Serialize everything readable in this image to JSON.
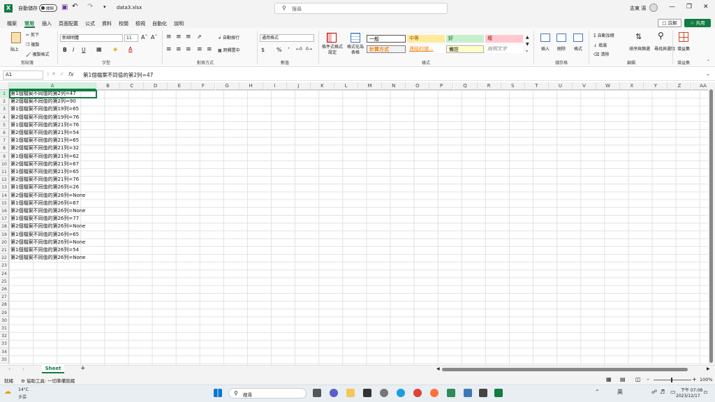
{
  "titlebar": {
    "autosave_label": "自動儲存",
    "autosave_state": "關閉",
    "filename": "data3.xlsx",
    "search_placeholder": "搜尋",
    "user": "志東 湯"
  },
  "ribbon_tabs": [
    "檔案",
    "常用",
    "插入",
    "頁面配置",
    "公式",
    "資料",
    "校閱",
    "檢視",
    "自動化",
    "說明"
  ],
  "comment_label": "註解",
  "share_label": "共用",
  "ribbon": {
    "clipboard": {
      "paste": "貼上",
      "cut": "剪下",
      "copy": "複製",
      "format_painter": "複製格式",
      "label": "剪貼簿"
    },
    "font": {
      "name": "新細明體",
      "size": "11",
      "bold": "B",
      "italic": "I",
      "underline": "U",
      "label": "字型"
    },
    "alignment": {
      "wrap": "自動換行",
      "merge": "跨欄置中",
      "label": "對齊方式"
    },
    "number": {
      "format": "通用格式",
      "label": "數值"
    },
    "styles": {
      "conditional": "條件式格式設定",
      "format_table": "格式化為表格",
      "cells": [
        {
          "text": "一般",
          "bg": "#ffffff",
          "color": "#000000"
        },
        {
          "text": "中等",
          "bg": "#ffeb9c",
          "color": "#9c5700"
        },
        {
          "text": "好",
          "bg": "#c6efce",
          "color": "#006100"
        },
        {
          "text": "壞",
          "bg": "#ffc7ce",
          "color": "#9c0006"
        },
        {
          "text": "計算方式",
          "bg": "#f2f2f2",
          "color": "#fa7d00"
        },
        {
          "text": "連結的儲...",
          "bg": "#ffffff",
          "color": "#fa7d00"
        },
        {
          "text": "備註",
          "bg": "#ffffcc",
          "color": "#000000"
        },
        {
          "text": "說明文字",
          "bg": "#ffffff",
          "color": "#7f7f7f"
        }
      ],
      "label": "樣式"
    },
    "cells": {
      "insert": "插入",
      "delete": "刪除",
      "format": "格式",
      "label": "儲存格"
    },
    "editing": {
      "autosum": "自動加總",
      "fill": "填滿",
      "clear": "清除",
      "sort": "排序與篩選",
      "find": "尋找與選取",
      "label": "編輯"
    },
    "addins": {
      "addin": "增益集",
      "label": "增益集"
    }
  },
  "formula_bar": {
    "name_box": "A1",
    "fx": "fx",
    "content": "第1個檔案不同值的第2列=47"
  },
  "columns": [
    "A",
    "B",
    "C",
    "D",
    "E",
    "F",
    "G",
    "H",
    "I",
    "J",
    "K",
    "L",
    "M",
    "N",
    "O",
    "P",
    "Q",
    "R",
    "S",
    "T",
    "U",
    "V",
    "W",
    "X",
    "Y",
    "Z",
    "AA"
  ],
  "row_count": 35,
  "cells_A": [
    "第1個檔案不同值的第2列=47",
    "第2個檔案不同值的第2列=90",
    "第1個檔案不同值的第19列=65",
    "第2個檔案不同值的第19列=76",
    "第1個檔案不同值的第21列=76",
    "第2個檔案不同值的第21列=54",
    "第1個檔案不同值的第21列=65",
    "第2個檔案不同值的第21列=32",
    "第1個檔案不同值的第21列=62",
    "第2個檔案不同值的第21列=67",
    "第1個檔案不同值的第21列=65",
    "第2個檔案不同值的第21列=76",
    "第1個檔案不同值的第26列=26",
    "第2個檔案不同值的第26列=None",
    "第1個檔案不同值的第26列=67",
    "第2個檔案不同值的第26列=None",
    "第1個檔案不同值的第26列=77",
    "第2個檔案不同值的第26列=None",
    "第1個檔案不同值的第26列=65",
    "第2個檔案不同值的第26列=None",
    "第1個檔案不同值的第26列=54",
    "第2個檔案不同值的第26列=None"
  ],
  "sheet_tab": "Sheet",
  "status": {
    "ready": "就緒",
    "accessibility": "協助工具: 一切準備就緒",
    "zoom": "100%"
  },
  "taskbar": {
    "weather_temp": "14°C",
    "weather_desc": "多雲",
    "search": "搜尋",
    "ime": "英",
    "time": "下午 07:08",
    "date": "2023/12/17"
  }
}
